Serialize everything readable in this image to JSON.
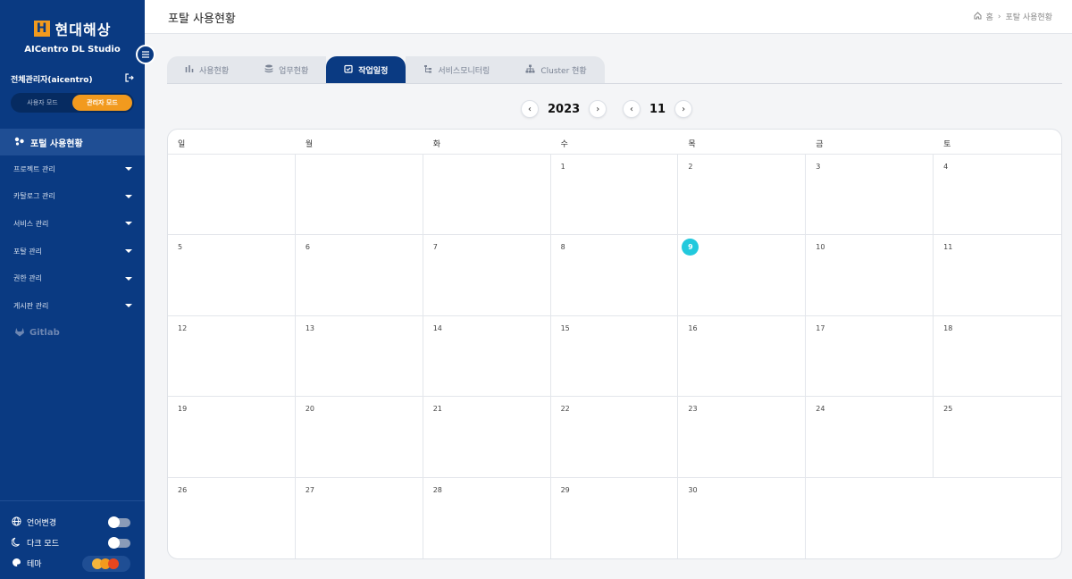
{
  "sidebar": {
    "logo_text": "현대해상",
    "logo_mark": "H",
    "app_name": "AICentro DL Studio",
    "user_name": "전체관리자(aicentro)",
    "mode_user": "사용자 모드",
    "mode_admin": "관리자 모드",
    "active_item": "포털 사용현황",
    "items": [
      {
        "label": "프로젝트 관리"
      },
      {
        "label": "카탈로그 관리"
      },
      {
        "label": "서비스 관리"
      },
      {
        "label": "포탈 관리"
      },
      {
        "label": "권한 관리"
      },
      {
        "label": "게시판 관리"
      }
    ],
    "gitlab": "Gitlab",
    "settings": {
      "language": "언어변경",
      "dark_mode": "다크 모드",
      "theme": "테마"
    }
  },
  "header": {
    "title": "포탈 사용현황",
    "breadcrumb_home": "홈",
    "breadcrumb_current": "포탈 사용현황"
  },
  "tabs": [
    {
      "label": "사용현황",
      "icon": "bar-chart-icon"
    },
    {
      "label": "업무현황",
      "icon": "database-icon"
    },
    {
      "label": "작업일정",
      "icon": "calendar-check-icon"
    },
    {
      "label": "서비스모니터링",
      "icon": "hierarchy-icon"
    },
    {
      "label": "Cluster 현황",
      "icon": "sitemap-icon"
    }
  ],
  "calendar": {
    "year": "2023",
    "month": "11",
    "weekdays": [
      "일",
      "월",
      "화",
      "수",
      "목",
      "금",
      "토"
    ],
    "days": [
      "",
      "",
      "",
      "1",
      "2",
      "3",
      "4",
      "5",
      "6",
      "7",
      "8",
      "9",
      "10",
      "11",
      "12",
      "13",
      "14",
      "15",
      "16",
      "17",
      "18",
      "19",
      "20",
      "21",
      "22",
      "23",
      "24",
      "25",
      "26",
      "27",
      "28",
      "29",
      "30",
      "",
      ""
    ],
    "today": "9"
  },
  "colors": {
    "sidebar_bg": "#0a3a82",
    "accent_orange": "#f29a1e",
    "today_cyan": "#22c9dd",
    "theme_dots": [
      "#f6b53c",
      "#f29a1e",
      "#e8461e"
    ]
  }
}
